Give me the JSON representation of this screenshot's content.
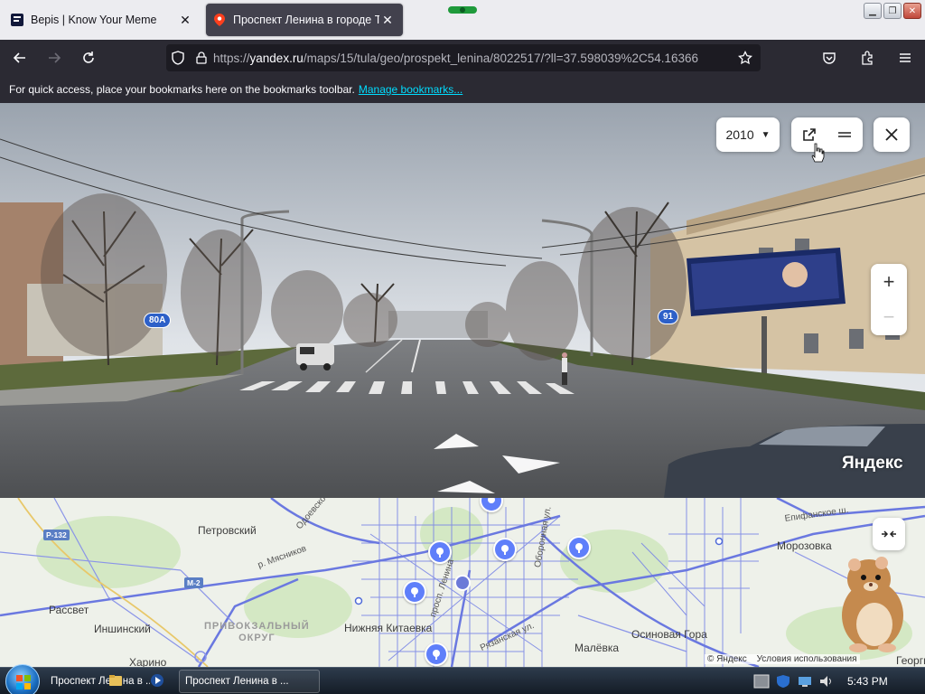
{
  "browser": {
    "tabs": [
      {
        "title": "Bepis | Know Your Meme",
        "active": false
      },
      {
        "title": "Проспект Ленина в городе Ту",
        "active": true
      }
    ],
    "url_prefix": "https://",
    "url_host": "yandex.ru",
    "url_path": "/maps/15/tula/geo/prospekt_lenina/8022517/?ll=37.598039%2C54.16366",
    "bookmarks_hint": "For quick access, place your bookmarks here on the bookmarks toolbar.",
    "bookmarks_link": "Manage bookmarks..."
  },
  "panorama": {
    "year": "2010",
    "logo": "Яндекс",
    "badges": [
      "80A",
      "91"
    ]
  },
  "map": {
    "labels": {
      "petrovsky": "Петровский",
      "rassvet": "Рассвет",
      "inshinsky": "Иншинский",
      "harino": "Харино",
      "district": "ПРИВОКЗАЛЬНЫЙ\nОКРУГ",
      "nizhnyaya": "Нижняя Китаевка",
      "osinovaya": "Осиновая Гора",
      "maleevka": "Малёвка",
      "morozovka": "Морозовка",
      "prospect": "просп. Ленина",
      "ryazanskaya": "Рязанская ул.",
      "oboronnaya": "Оборонная ул.",
      "myasnikov": "р. Мясников",
      "osovskaya": "Одоевское ш.",
      "epifanskoe": "Епифанское ш.",
      "georgi": "Георги"
    },
    "road_shields": [
      "Р-132",
      "М-2"
    ],
    "attribution": "© Яндекс",
    "terms": "Условия использования"
  },
  "taskbar": {
    "items": [
      "Проспект Ленина в ...",
      "Проспект Ленина в ..."
    ],
    "clock": "5:43 PM"
  },
  "colors": {
    "map_roads": "#6f7ee6",
    "poi": "#5f7ffa",
    "browser_dark": "#2b2a33"
  }
}
